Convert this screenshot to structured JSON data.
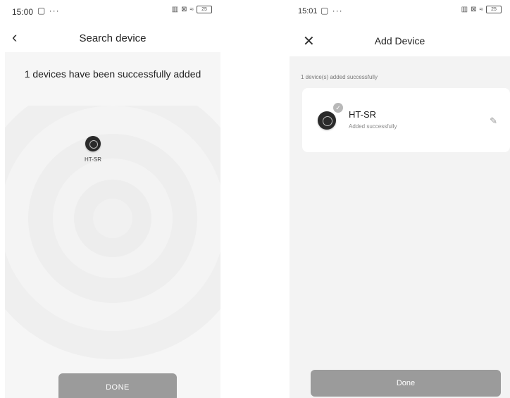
{
  "left": {
    "status_time": "15:00",
    "status_extra": "▢ ···",
    "nav_title": "Search device",
    "back_icon": "‹",
    "success_message": "1 devices have been successfully added",
    "device_label": "HT-SR",
    "done_label": "DONE"
  },
  "right": {
    "status_time": "15:01",
    "status_extra": "▢ ···",
    "nav_title": "Add Device",
    "close_icon": "✕",
    "sub_message": "1 device(s) added successfully",
    "device_name": "HT-SR",
    "device_status": "Added successfully",
    "edit_icon": "✎",
    "check_icon": "✓",
    "done_label": "Done"
  },
  "status_icons": {
    "signal": "▥",
    "x_box": "⊠",
    "wifi": "≈",
    "battery": "25"
  }
}
